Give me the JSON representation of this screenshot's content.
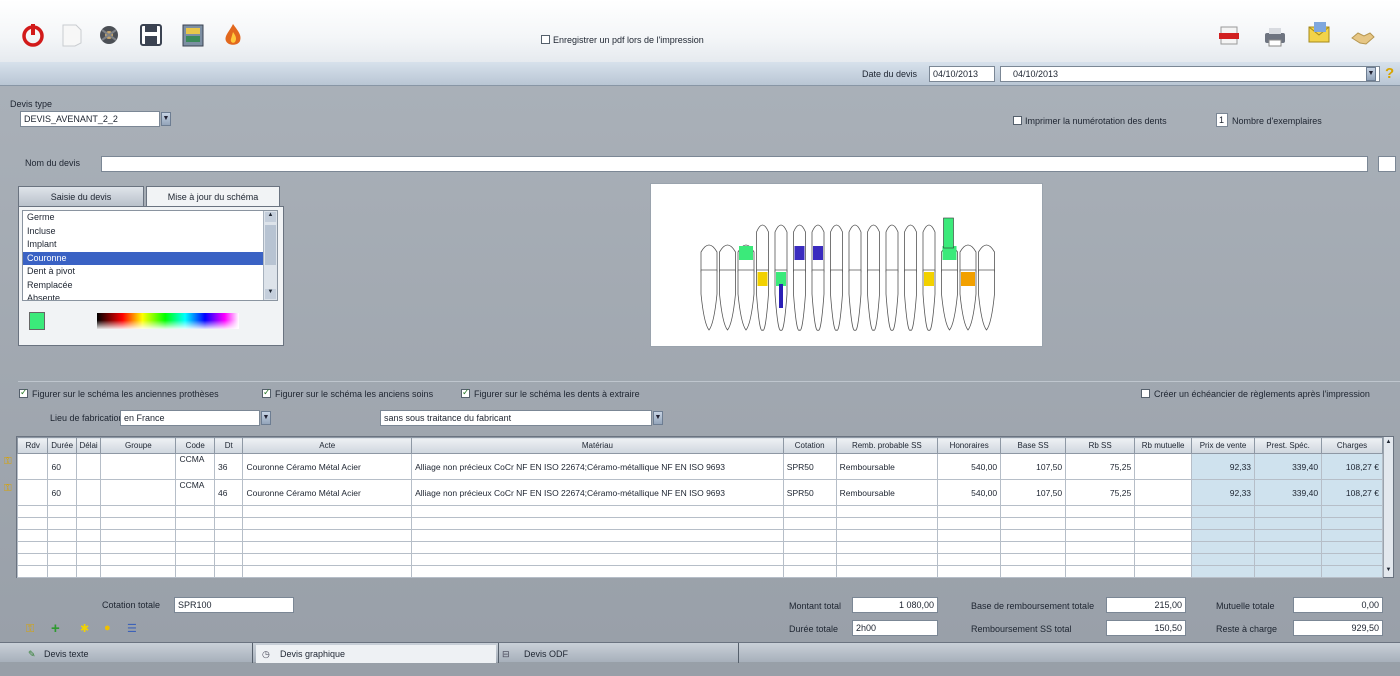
{
  "toolbar": {
    "icons": [
      "power-icon",
      "blank-document-icon",
      "gear-icon",
      "save-icon",
      "tooth-chart-icon",
      "flame-icon",
      "pdf-icon",
      "printer-icon",
      "mail-icon",
      "handshake-icon"
    ],
    "pdf_checkbox_label": "Enregistrer un pdf lors de l'impression"
  },
  "date_bar": {
    "label": "Date du devis",
    "date_value": "04/10/2013",
    "date_combo_value": "04/10/2013",
    "help_icon": "?"
  },
  "devis_type": {
    "label": "Devis type",
    "value": "DEVIS_AVENANT_2_2"
  },
  "print_options": {
    "numbering_label": "Imprimer la numérotation des dents",
    "copies_value": "1",
    "copies_label": "Nombre d'exemplaires"
  },
  "devis_name": {
    "label": "Nom du devis",
    "value": ""
  },
  "tabs": [
    {
      "label": "Saisie du devis",
      "active": false
    },
    {
      "label": "Mise à jour du schéma",
      "active": true
    }
  ],
  "state_list": {
    "items": [
      "Germe",
      "Incluse",
      "Implant",
      "Couronne",
      "Dent à pivot",
      "Remplacée",
      "Absente"
    ],
    "selected_index": 3,
    "selected_color": "#3bea7a"
  },
  "schema_options": {
    "old_prostheses": "Figurer sur le schéma les anciennes prothèses",
    "old_care": "Figurer sur le schéma les anciens soins",
    "teeth_extract": "Figurer sur le schéma les dents à extraire",
    "payment_schedule": "Créer un échéancier de règlements après l'impression"
  },
  "fabrication": {
    "label": "Lieu de fabrication",
    "value": "en France",
    "subcontract_value": "sans sous traitance du fabricant"
  },
  "grid": {
    "columns": [
      "Rdv",
      "Durée",
      "Délai",
      "Groupe",
      "Code",
      "Dt",
      "Acte",
      "Matériau",
      "Cotation",
      "Remb. probable SS",
      "Honoraires",
      "Base SS",
      "Rb SS",
      "Rb mutuelle",
      "Prix de vente",
      "Prest. Spéc.",
      "Charges"
    ],
    "rows": [
      {
        "rdv": "",
        "duree": "60",
        "delai": "",
        "groupe": "",
        "code": "CCMA",
        "dt": "36",
        "acte": "Couronne Céramo Métal Acier",
        "materiau": "Alliage non précieux CoCr NF EN ISO 22674;Céramo-métallique NF EN ISO 9693",
        "cotation": "SPR50",
        "remb": "Remboursable",
        "honoraires": "540,00",
        "base_ss": "107,50",
        "rb_ss": "75,25",
        "rb_mut": "",
        "prix_vente": "92,33",
        "prest": "339,40",
        "charges": "108,27 €"
      },
      {
        "rdv": "",
        "duree": "60",
        "delai": "",
        "groupe": "",
        "code": "CCMA",
        "dt": "46",
        "acte": "Couronne Céramo Métal Acier",
        "materiau": "Alliage non précieux CoCr NF EN ISO 22674;Céramo-métallique NF EN ISO 9693",
        "cotation": "SPR50",
        "remb": "Remboursable",
        "honoraires": "540,00",
        "base_ss": "107,50",
        "rb_ss": "75,25",
        "rb_mut": "",
        "prix_vente": "92,33",
        "prest": "339,40",
        "charges": "108,27 €"
      }
    ]
  },
  "totals": {
    "cotation_label": "Cotation totale",
    "cotation_value": "SPR100",
    "montant_label": "Montant total",
    "montant_value": "1 080,00",
    "duree_label": "Durée totale",
    "duree_value": "2h00",
    "base_label": "Base de remboursement totale",
    "base_value": "215,00",
    "remb_ss_label": "Remboursement SS total",
    "remb_ss_value": "150,50",
    "mutuelle_label": "Mutuelle totale",
    "mutuelle_value": "0,00",
    "reste_label": "Reste à charge",
    "reste_value": "929,50"
  },
  "bottom_tabs": [
    "Devis texte",
    "Devis graphique",
    "Devis ODF"
  ]
}
